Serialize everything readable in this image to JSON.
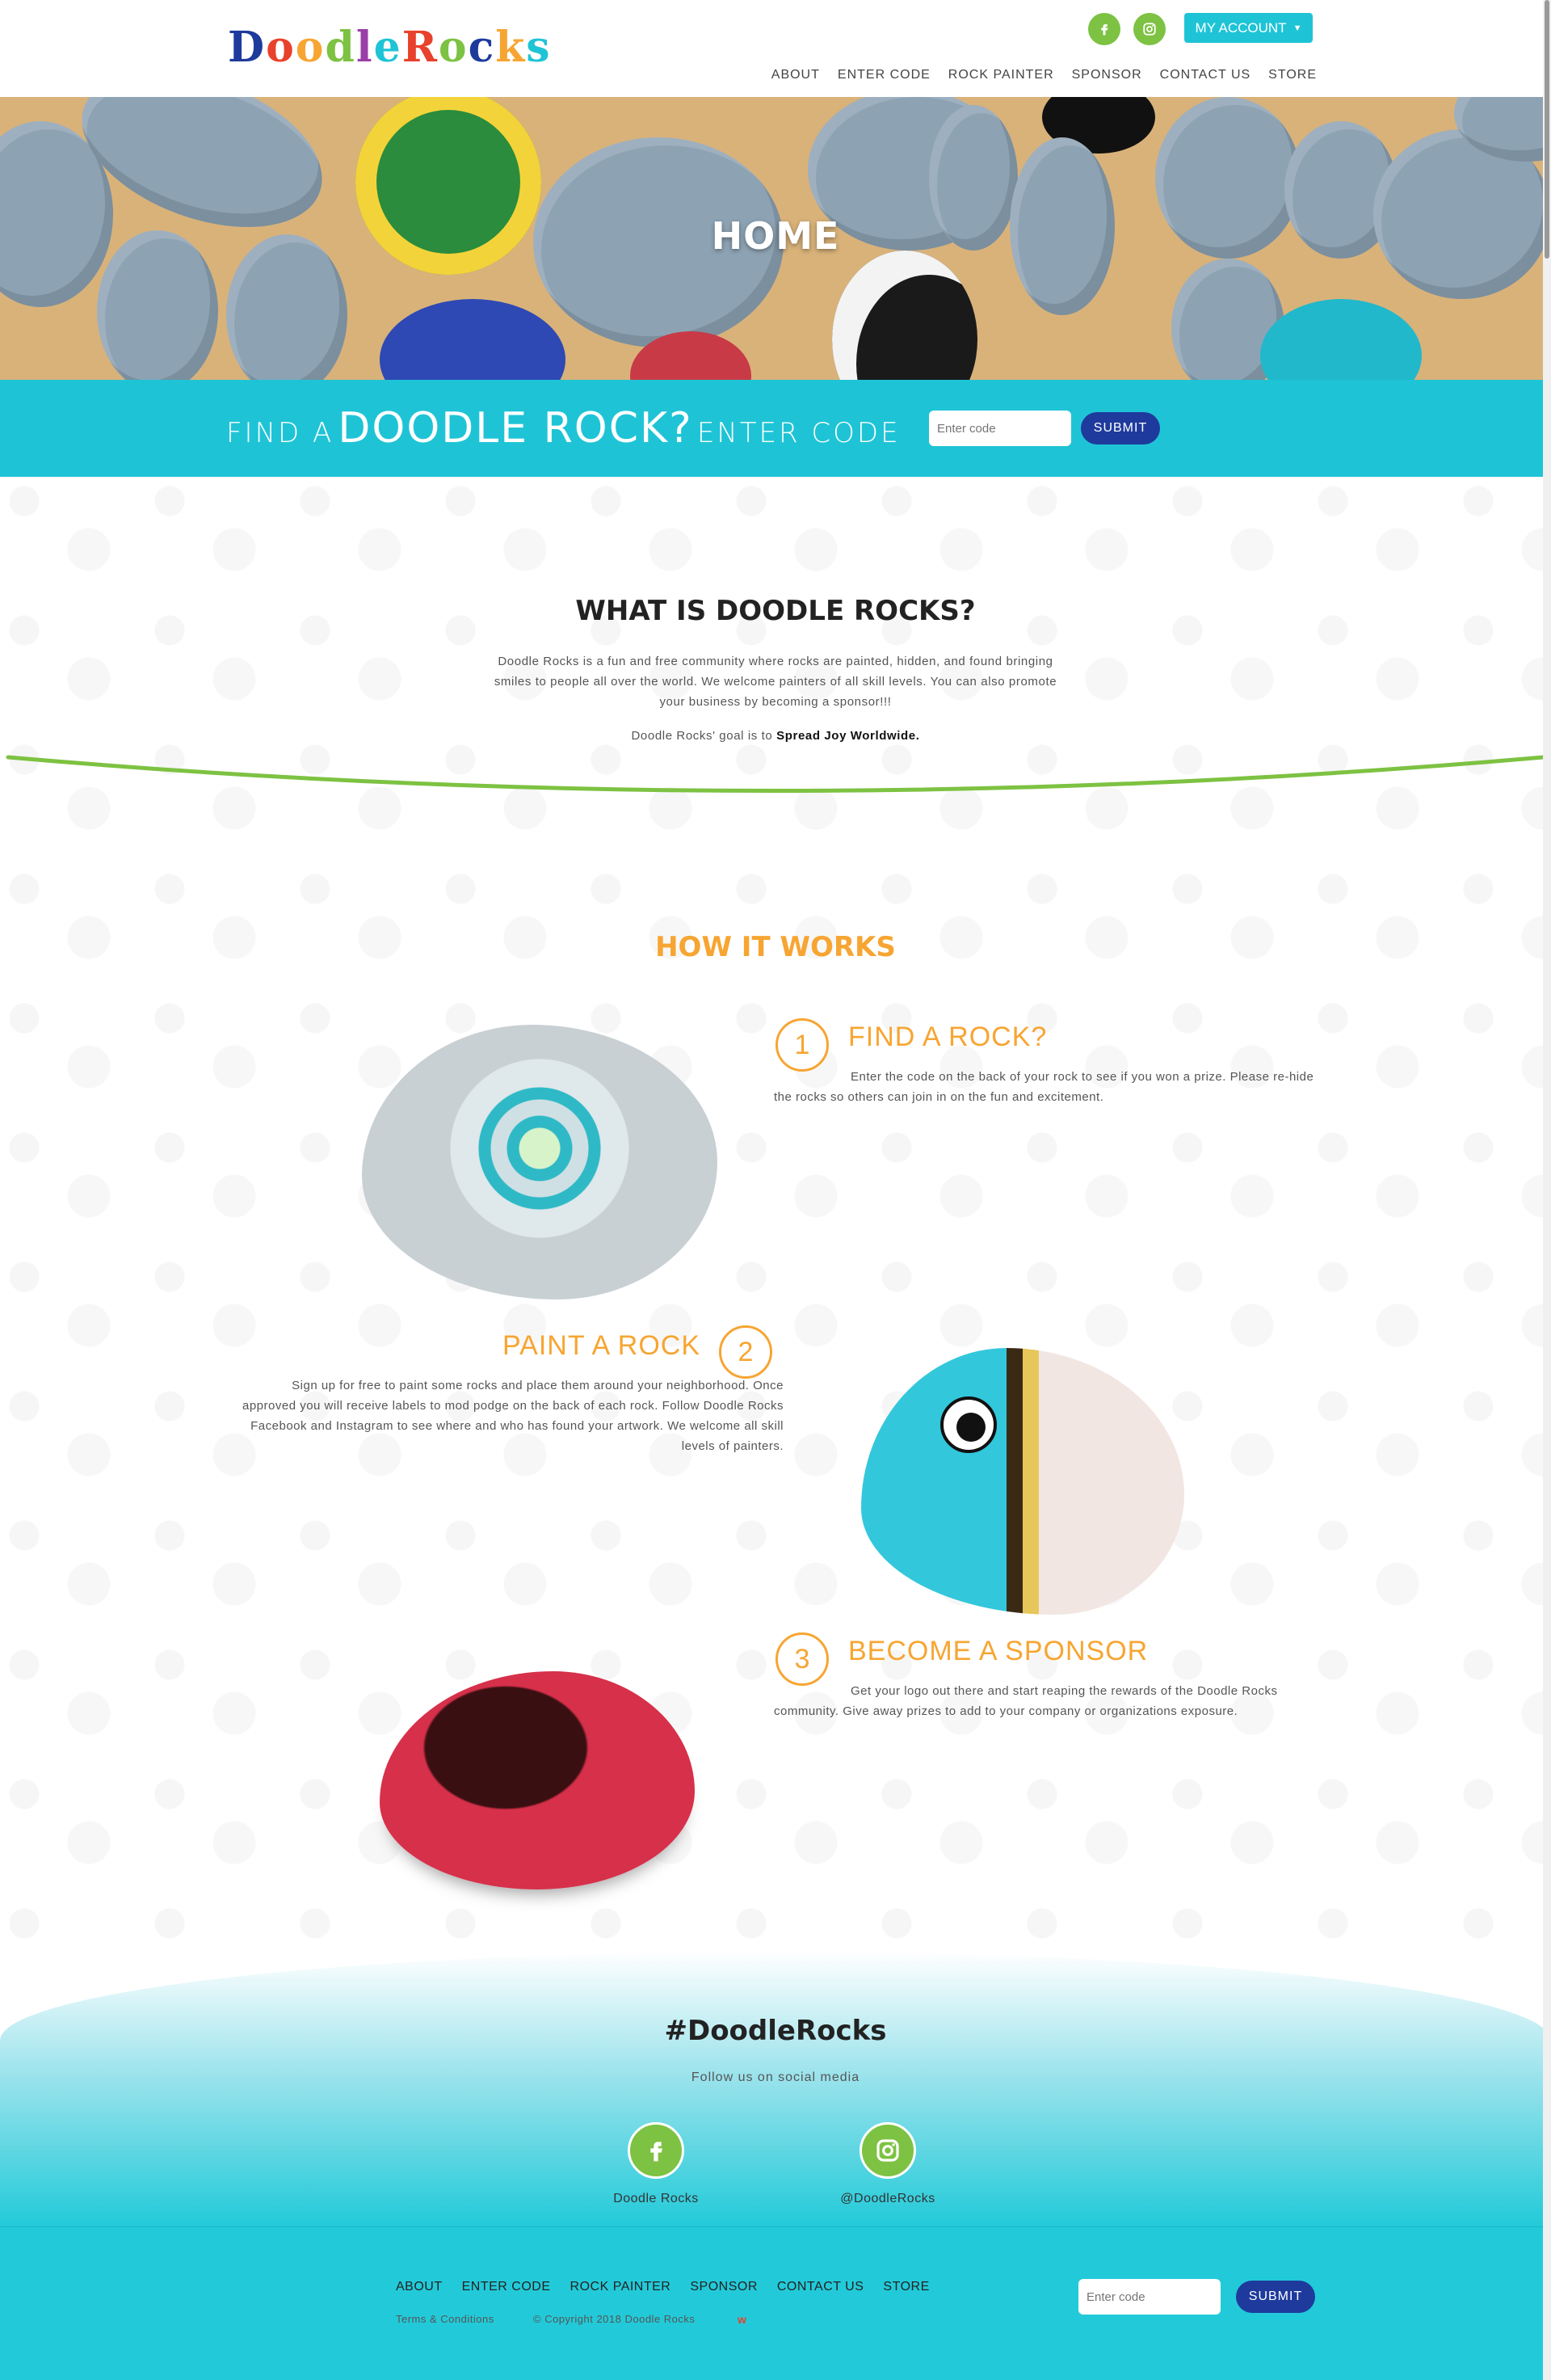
{
  "header": {
    "logo": {
      "letters": [
        "D",
        "o",
        "o",
        "d",
        "l",
        "e",
        " ",
        "R",
        "o",
        "c",
        "k",
        "s"
      ],
      "text": "Doodle Rocks"
    },
    "account_label": "MY ACCOUNT",
    "nav": [
      "ABOUT",
      "ENTER CODE",
      "ROCK PAINTER",
      "SPONSOR",
      "CONTACT US",
      "STORE"
    ]
  },
  "hero": {
    "title": "HOME"
  },
  "code_bar": {
    "find_a": "FIND A",
    "doodle_rock": "DOODLE ROCK?",
    "enter_code": "ENTER CODE",
    "placeholder": "Enter code",
    "submit": "SUBMIT"
  },
  "about": {
    "title": "WHAT IS DOODLE ROCKS?",
    "text": "Doodle Rocks is a fun and free community where rocks are painted, hidden, and found bringing smiles to people all over the world. We welcome painters of all skill levels. You can also promote your business by becoming a sponsor!!!",
    "goal_prefix": "Doodle Rocks' goal is to",
    "goal_highlight": "Spread Joy Worldwide."
  },
  "how": {
    "title": "HOW IT WORKS",
    "steps": [
      {
        "num": "1",
        "title": "FIND A ROCK?",
        "text": "Enter the code on the back of your rock to see if you won a prize. Please re-hide the rocks so others can join in on the fun and excitement."
      },
      {
        "num": "2",
        "title": "PAINT A ROCK",
        "text": "Sign up for free to paint some rocks and place them around your neighborhood. Once approved you will receive labels to mod podge on the back of each rock. Follow Doodle Rocks Facebook and Instagram to see where and who has found your artwork. We welcome all skill levels of painters."
      },
      {
        "num": "3",
        "title": "BECOME A SPONSOR",
        "text": "Get your logo out there and start reaping the rewards of the Doodle Rocks community. Give away prizes to add to your company or organizations exposure."
      }
    ]
  },
  "social": {
    "hashtag": "#DoodleRocks",
    "follow": "Follow us on social media",
    "facebook_label": "Doodle Rocks",
    "instagram_label": "@DoodleRocks"
  },
  "footer": {
    "nav": [
      "ABOUT",
      "ENTER CODE",
      "ROCK PAINTER",
      "SPONSOR",
      "CONTACT US",
      "STORE"
    ],
    "terms": "Terms & Conditions",
    "copyright": "© Copyright 2018 Doodle Rocks",
    "placeholder": "Enter code",
    "submit": "SUBMIT"
  },
  "colors": {
    "teal": "#1ec4d6",
    "green": "#7dc242",
    "orange": "#f7a532",
    "navy": "#1e3a9c"
  }
}
